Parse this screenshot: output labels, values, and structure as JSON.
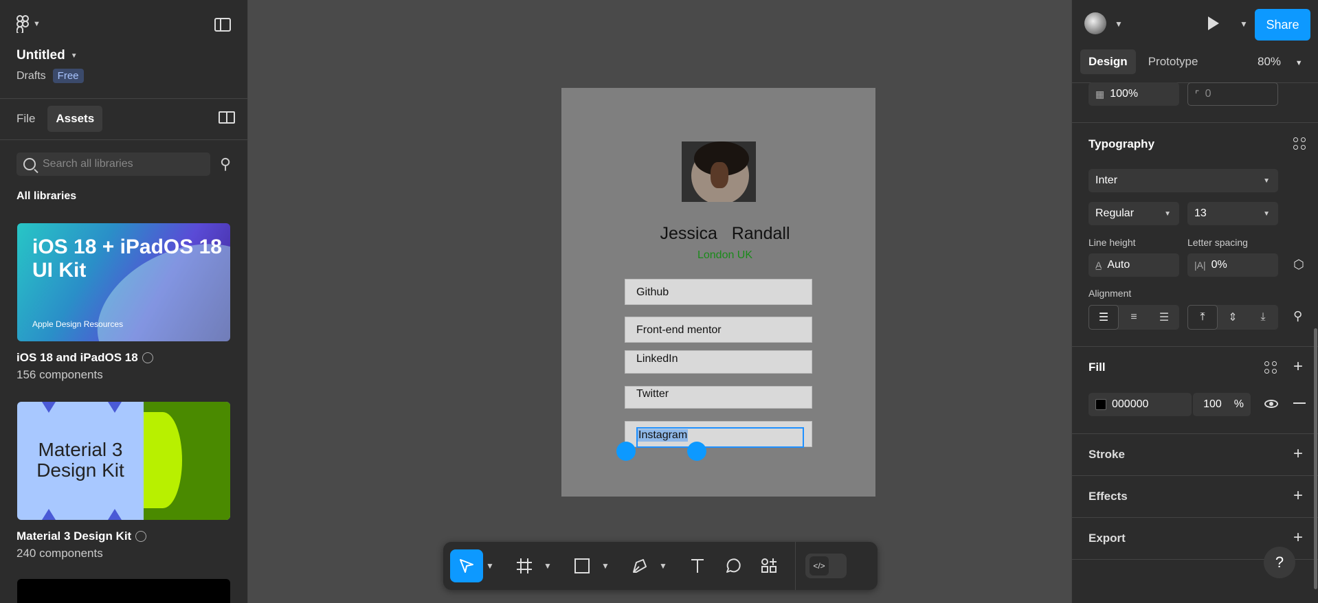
{
  "app": {
    "file_title": "Untitled",
    "location": "Drafts",
    "plan_badge": "Free"
  },
  "left_tabs": [
    "File",
    "Assets"
  ],
  "search": {
    "placeholder": "Search all libraries"
  },
  "all_libraries_label": "All libraries",
  "libraries": [
    {
      "thumb_title": "iOS 18 + iPadOS 18 UI Kit",
      "thumb_sub": "Apple Design Resources",
      "name": "iOS 18 and iPadOS 18",
      "count": "156 components"
    },
    {
      "thumb_title": "Material 3 Design Kit",
      "name": "Material 3 Design Kit",
      "count": "240 components"
    }
  ],
  "canvas": {
    "first_name": "Jessica",
    "last_name": "Randall",
    "location": "London UK",
    "links": [
      "Github",
      "Front-end mentor",
      "LinkedIn",
      "Twitter",
      "Instagram"
    ]
  },
  "toolbar": {
    "tools": [
      "move-tool",
      "frame-tool",
      "shape-tool",
      "pen-tool",
      "text-tool",
      "comment-tool",
      "actions-tool"
    ],
    "code_glyph": "</>"
  },
  "right": {
    "share_label": "Share",
    "tabs": [
      "Design",
      "Prototype"
    ],
    "zoom": "80%",
    "opacity": "100%",
    "corner_radius": "0",
    "typography_title": "Typography",
    "font_family": "Inter",
    "font_weight": "Regular",
    "font_size": "13",
    "line_height_label": "Line height",
    "line_height": "Auto",
    "letter_spacing_label": "Letter spacing",
    "letter_spacing": "0%",
    "alignment_label": "Alignment",
    "fill_title": "Fill",
    "fill_hex": "000000",
    "fill_opacity": "100",
    "fill_unit": "%",
    "stroke_title": "Stroke",
    "effects_title": "Effects",
    "export_title": "Export",
    "help": "?"
  },
  "colors": {
    "accent": "#0d99ff",
    "panel": "#2c2c2c",
    "canvas": "#4a4a4a",
    "frame": "#7f7f7f",
    "location_text": "#1a8a1a"
  }
}
